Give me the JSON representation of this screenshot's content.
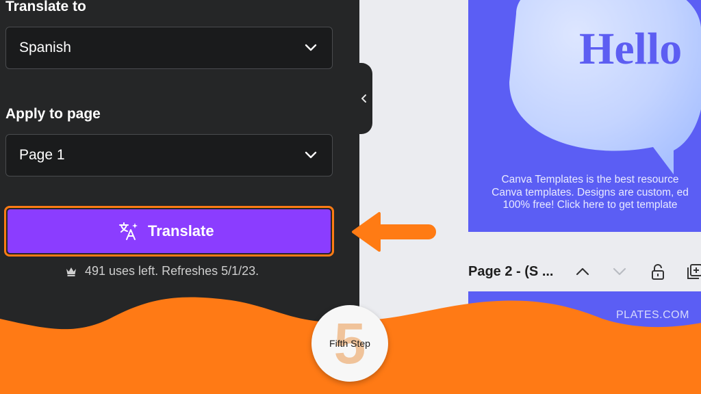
{
  "panel": {
    "translate_to_label": "Translate to",
    "language_value": "Spanish",
    "apply_label": "Apply to page",
    "page_value": "Page 1",
    "translate_button": "Translate",
    "uses_text": "491 uses left. Refreshes 5/1/23."
  },
  "canvas": {
    "hello": "Hello",
    "blurb_lines": [
      "Canva Templates is the best resource",
      "Canva templates. Designs are custom, ed",
      "100% free! Click here to get template"
    ],
    "page2_title": "Page 2 - (S ...",
    "card_two_text": "PLATES.COM"
  },
  "step": {
    "number": "5",
    "label": "Fifth Step"
  },
  "colors": {
    "accent_purple": "#8b3dff",
    "highlight_orange": "#ff7b14",
    "panel_dark": "#252627",
    "canvas_blue": "#5b5ef4"
  },
  "icons": [
    "chevron-down-icon",
    "chevron-left-icon",
    "translate-icon",
    "crown-icon",
    "chevron-up-icon",
    "lock-icon",
    "duplicate-icon",
    "arrow-left-icon"
  ]
}
